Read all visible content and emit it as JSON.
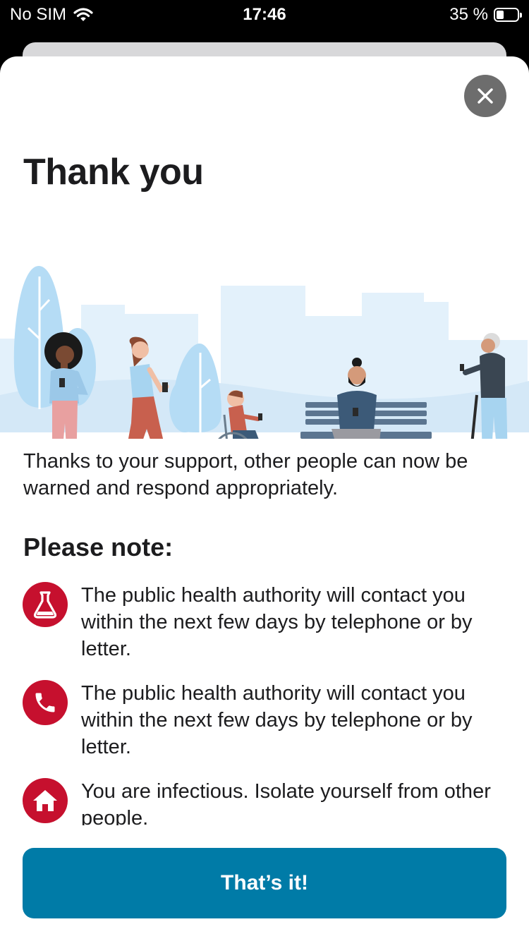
{
  "status_bar": {
    "carrier": "No SIM",
    "time": "17:46",
    "battery_text": "35 %",
    "battery_level": 0.35
  },
  "sheet": {
    "close_icon": "close-icon",
    "title": "Thank you",
    "intro": "Thanks to your support, other people can now be warned and respond appropriately.",
    "note_heading": "Please note:",
    "notes": [
      {
        "icon": "flask-icon",
        "text": "The public health authority will contact you within the next few days by telephone or by letter."
      },
      {
        "icon": "phone-icon",
        "text": "The public health authority will contact you within the next few days by telephone or by letter."
      },
      {
        "icon": "home-icon",
        "text": "You are infectious. Isolate yourself from other people."
      }
    ],
    "button_label": "That’s it!"
  },
  "colors": {
    "accent_red": "#c6102e",
    "button_blue": "#007ba7",
    "close_gray": "#6d6d6d",
    "sky_blue": "#e3f1fb"
  }
}
